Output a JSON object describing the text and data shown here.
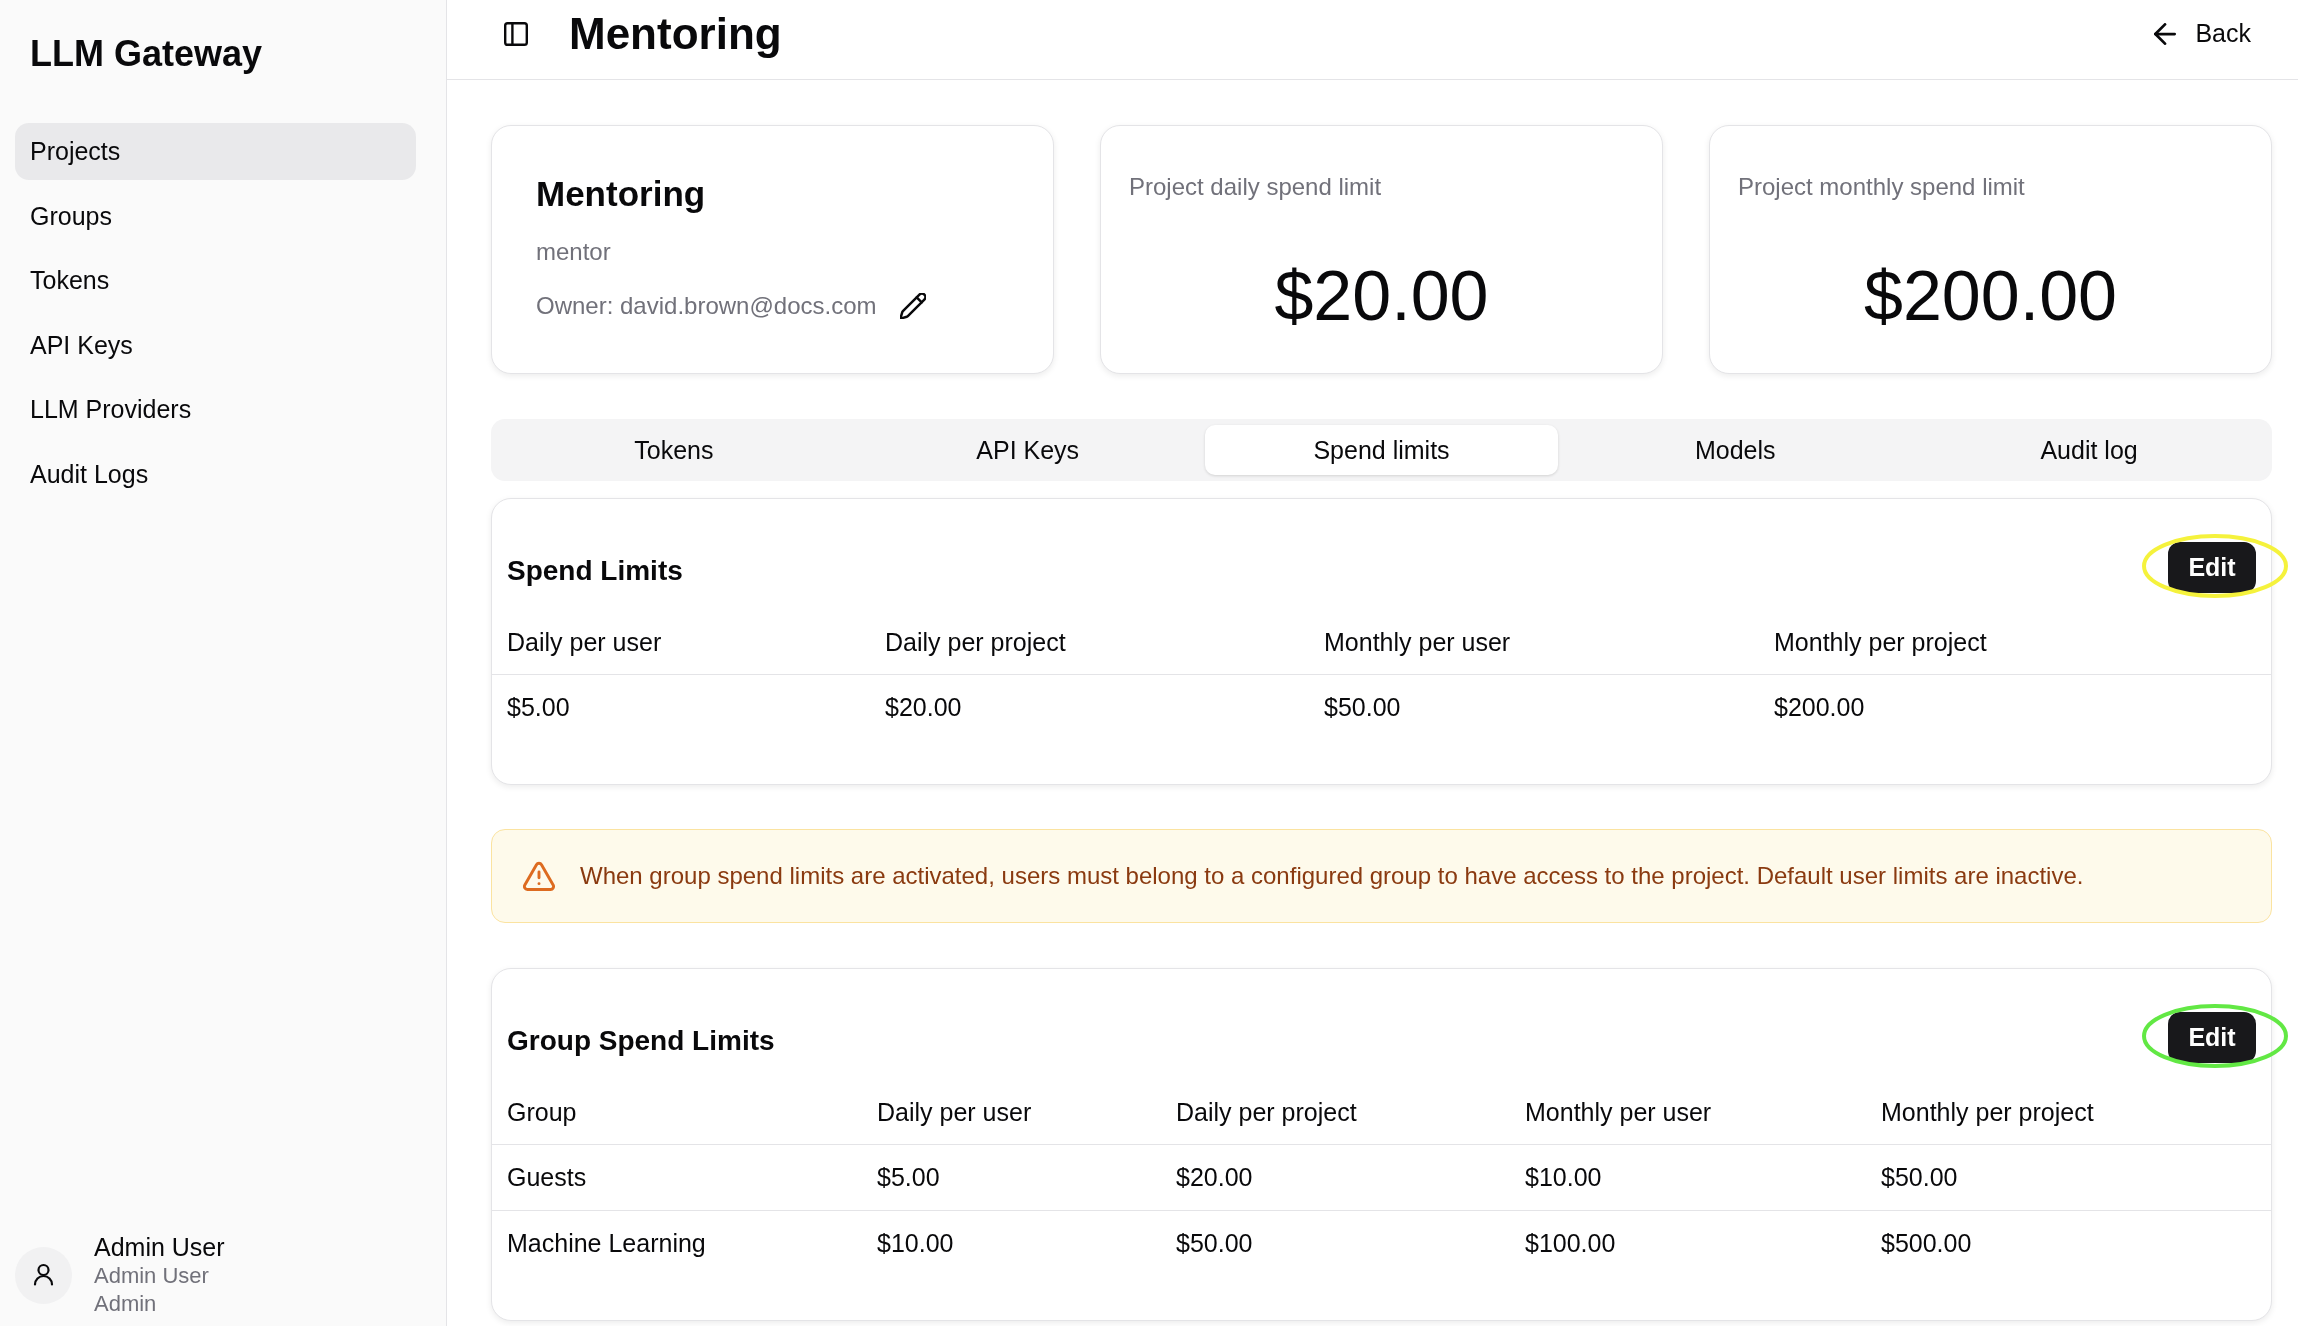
{
  "sidebar": {
    "title": "LLM Gateway",
    "items": [
      {
        "label": "Projects",
        "selected": true
      },
      {
        "label": "Groups",
        "selected": false
      },
      {
        "label": "Tokens",
        "selected": false
      },
      {
        "label": "API Keys",
        "selected": false
      },
      {
        "label": "LLM Providers",
        "selected": false
      },
      {
        "label": "Audit Logs",
        "selected": false
      }
    ],
    "user": {
      "name": "Admin User",
      "display_name": "Admin User",
      "role": "Admin"
    }
  },
  "header": {
    "title": "Mentoring",
    "back": "Back"
  },
  "project_card": {
    "name": "Mentoring",
    "slug": "mentor",
    "owner": "Owner: david.brown@docs.com"
  },
  "stat_cards": [
    {
      "label": "Project daily spend limit",
      "value": "$20.00"
    },
    {
      "label": "Project monthly spend limit",
      "value": "$200.00"
    }
  ],
  "tabs": [
    {
      "label": "Tokens",
      "selected": false
    },
    {
      "label": "API Keys",
      "selected": false
    },
    {
      "label": "Spend limits",
      "selected": true
    },
    {
      "label": "Models",
      "selected": false
    },
    {
      "label": "Audit log",
      "selected": false
    }
  ],
  "spend_limits": {
    "title": "Spend Limits",
    "edit_button": "Edit",
    "highlight": {
      "color": "#f5f23c"
    },
    "columns": [
      "Daily per user",
      "Daily per project",
      "Monthly per user",
      "Monthly per project"
    ],
    "rows": [
      [
        "$5.00",
        "$20.00",
        "$50.00",
        "$200.00"
      ]
    ]
  },
  "alert": {
    "text": "When group spend limits are activated, users must belong to a configured group to have access to the project. Default user limits are inactive."
  },
  "group_spend_limits": {
    "title": "Group Spend Limits",
    "edit_button": "Edit",
    "highlight": {
      "color": "#62e844"
    },
    "columns": [
      "Group",
      "Daily per user",
      "Daily per project",
      "Monthly per user",
      "Monthly per project"
    ],
    "rows": [
      [
        "Guests",
        "$5.00",
        "$20.00",
        "$10.00",
        "$50.00"
      ],
      [
        "Machine Learning",
        "$10.00",
        "$50.00",
        "$100.00",
        "$500.00"
      ]
    ]
  }
}
